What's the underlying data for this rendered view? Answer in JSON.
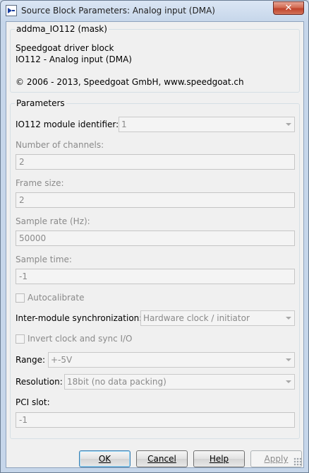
{
  "window": {
    "title": "Source Block Parameters: Analog input (DMA)",
    "close_label": "✕"
  },
  "mask": {
    "group_title": "addma_IO112 (mask)",
    "line1": "Speedgoat driver block",
    "line2": "IO112 - Analog input (DMA)",
    "copyright": "© 2006 - 2013, Speedgoat GmbH, www.speedgoat.ch"
  },
  "params": {
    "group_title": "Parameters",
    "module_id_label": "IO112 module identifier:",
    "module_id_value": "1",
    "channels_label": "Number of channels:",
    "channels_value": "2",
    "frame_label": "Frame size:",
    "frame_value": "2",
    "rate_label": "Sample rate (Hz):",
    "rate_value": "50000",
    "time_label": "Sample time:",
    "time_value": "-1",
    "autocal_label": "Autocalibrate",
    "autocal_checked": false,
    "sync_label": "Inter-module synchronization:",
    "sync_value": "Hardware clock / initiator",
    "invert_label": "Invert clock and sync I/O",
    "invert_checked": false,
    "range_label": "Range:",
    "range_value": "+-5V",
    "resolution_label": "Resolution:",
    "resolution_value": "18bit (no data packing)",
    "pci_label": "PCI slot:",
    "pci_value": "-1"
  },
  "buttons": {
    "ok": "OK",
    "cancel": "Cancel",
    "help": "Help",
    "apply": "Apply"
  }
}
